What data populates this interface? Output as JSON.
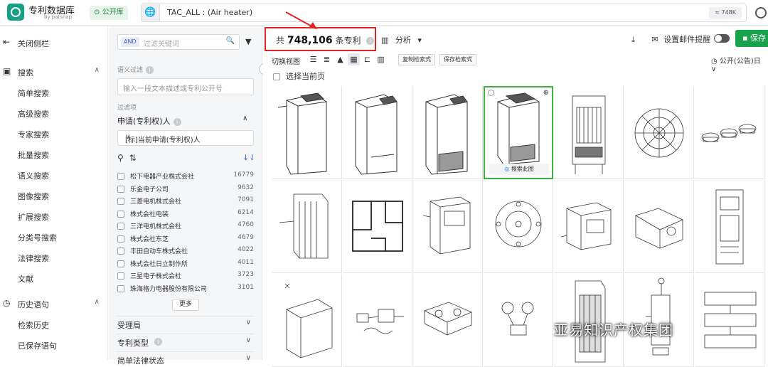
{
  "app": {
    "title": "专利数据库",
    "subtitle": "by patsnap",
    "public_label": "公开库",
    "query": "TAC_ALL : (Air heater)",
    "count_pill": "≈ 748K"
  },
  "nav": {
    "collapse": "关闭侧栏",
    "search_section": "搜索",
    "items": [
      "简单搜索",
      "高级搜索",
      "专家搜索",
      "批量搜索",
      "语义搜索",
      "图像搜索",
      "扩展搜索",
      "分类号搜索",
      "法律搜索",
      "文献"
    ],
    "history_section": "历史语句",
    "history_items": [
      "检索历史",
      "已保存语句"
    ]
  },
  "filter": {
    "and_tag": "AND",
    "keyword_placeholder": "过滤关键词",
    "semantic_label": "语义过滤",
    "semantic_placeholder": "输入一段文本描述或专利公开号",
    "filter_items_label": "过滤项",
    "applicant_title": "申请(专利权)人",
    "applicant_select": "[标]当前申请(专利权)人",
    "applicants": [
      {
        "name": "松下电器产业株式会社",
        "count": "16779"
      },
      {
        "name": "乐金电子公司",
        "count": "9632"
      },
      {
        "name": "三菱电机株式会社",
        "count": "7091"
      },
      {
        "name": "株式会社电装",
        "count": "6214"
      },
      {
        "name": "三洋电机株式会社",
        "count": "4760"
      },
      {
        "name": "株式会社东芝",
        "count": "4679"
      },
      {
        "name": "丰田自动车株式会社",
        "count": "4022"
      },
      {
        "name": "株式会社日立制作所",
        "count": "4011"
      },
      {
        "name": "三星电子株式会社",
        "count": "3723"
      },
      {
        "name": "珠海格力电器股份有限公司",
        "count": "3101"
      }
    ],
    "more": "更多",
    "sections": [
      "受理局",
      "专利类型",
      "简单法律状态"
    ]
  },
  "results": {
    "prefix": "共",
    "count": "748,106",
    "suffix": "条专利",
    "analysis": "分析",
    "email_alert": "设置邮件提醒",
    "save": "保存",
    "switch_view": "切换视图",
    "copy_query": "复制检索式",
    "save_query": "保存检索式",
    "sort": "公开(公告)日",
    "select_page": "选择当前页",
    "search_image": "搜索此图"
  },
  "watermark": "亚易知识产权集团",
  "colors": {
    "accent_green": "#16a34a",
    "highlight_red": "#e02424",
    "selected_border": "#3cb043"
  }
}
